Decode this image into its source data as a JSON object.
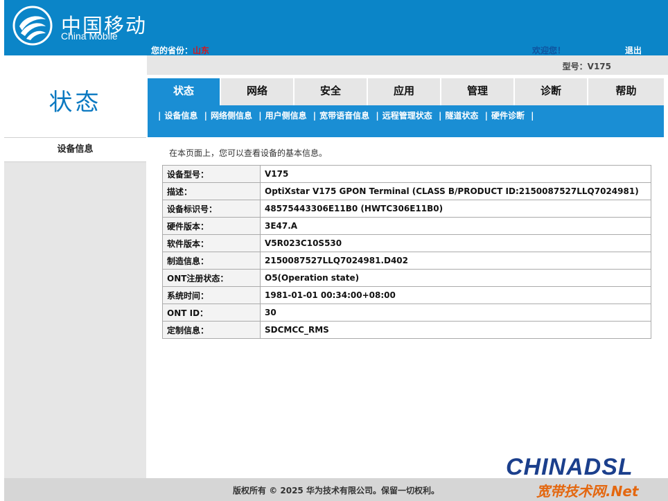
{
  "header": {
    "brand_cn": "中国移动",
    "brand_en": "China Mobile",
    "province_label": "您的省份：",
    "province_value": "山东",
    "welcome": "欢迎您！",
    "logout": "退出",
    "model": "型号：V175"
  },
  "page_title": "状态",
  "sidebar": {
    "items": [
      {
        "label": "设备信息"
      }
    ]
  },
  "tabs": [
    {
      "label": "状态",
      "active": true
    },
    {
      "label": "网络"
    },
    {
      "label": "安全"
    },
    {
      "label": "应用"
    },
    {
      "label": "管理"
    },
    {
      "label": "诊断"
    },
    {
      "label": "帮助"
    }
  ],
  "subnav": [
    "设备信息",
    "网络侧信息",
    "用户侧信息",
    "宽带语音信息",
    "远程管理状态",
    "隧道状态",
    "硬件诊断"
  ],
  "intro": "在本页面上，您可以查看设备的基本信息。",
  "device_info": [
    {
      "key": "设备型号：",
      "value": "V175"
    },
    {
      "key": "描述：",
      "value": "OptiXstar V175 GPON Terminal (CLASS B/PRODUCT ID:2150087527LLQ7024981)"
    },
    {
      "key": "设备标识号：",
      "value": "48575443306E11B0 (HWTC306E11B0)"
    },
    {
      "key": "硬件版本：",
      "value": "3E47.A"
    },
    {
      "key": "软件版本：",
      "value": "V5R023C10S530"
    },
    {
      "key": "制造信息：",
      "value": "2150087527LLQ7024981.D402"
    },
    {
      "key": "ONT注册状态：",
      "value": "O5(Operation state)"
    },
    {
      "key": "系统时间：",
      "value": "1981-01-01 00:34:00+08:00"
    },
    {
      "key": "ONT ID：",
      "value": "30"
    },
    {
      "key": "定制信息：",
      "value": "SDCMCC_RMS"
    }
  ],
  "footer": "版权所有 © 2025 华为技术有限公司。保留一切权利。",
  "watermark": {
    "top": "CHINADSL",
    "bottom": "宽带技术网.Net"
  },
  "colors": {
    "brand_blue": "#0b85c8",
    "tab_active": "#1a8ed4",
    "province_red": "#d8161b"
  }
}
